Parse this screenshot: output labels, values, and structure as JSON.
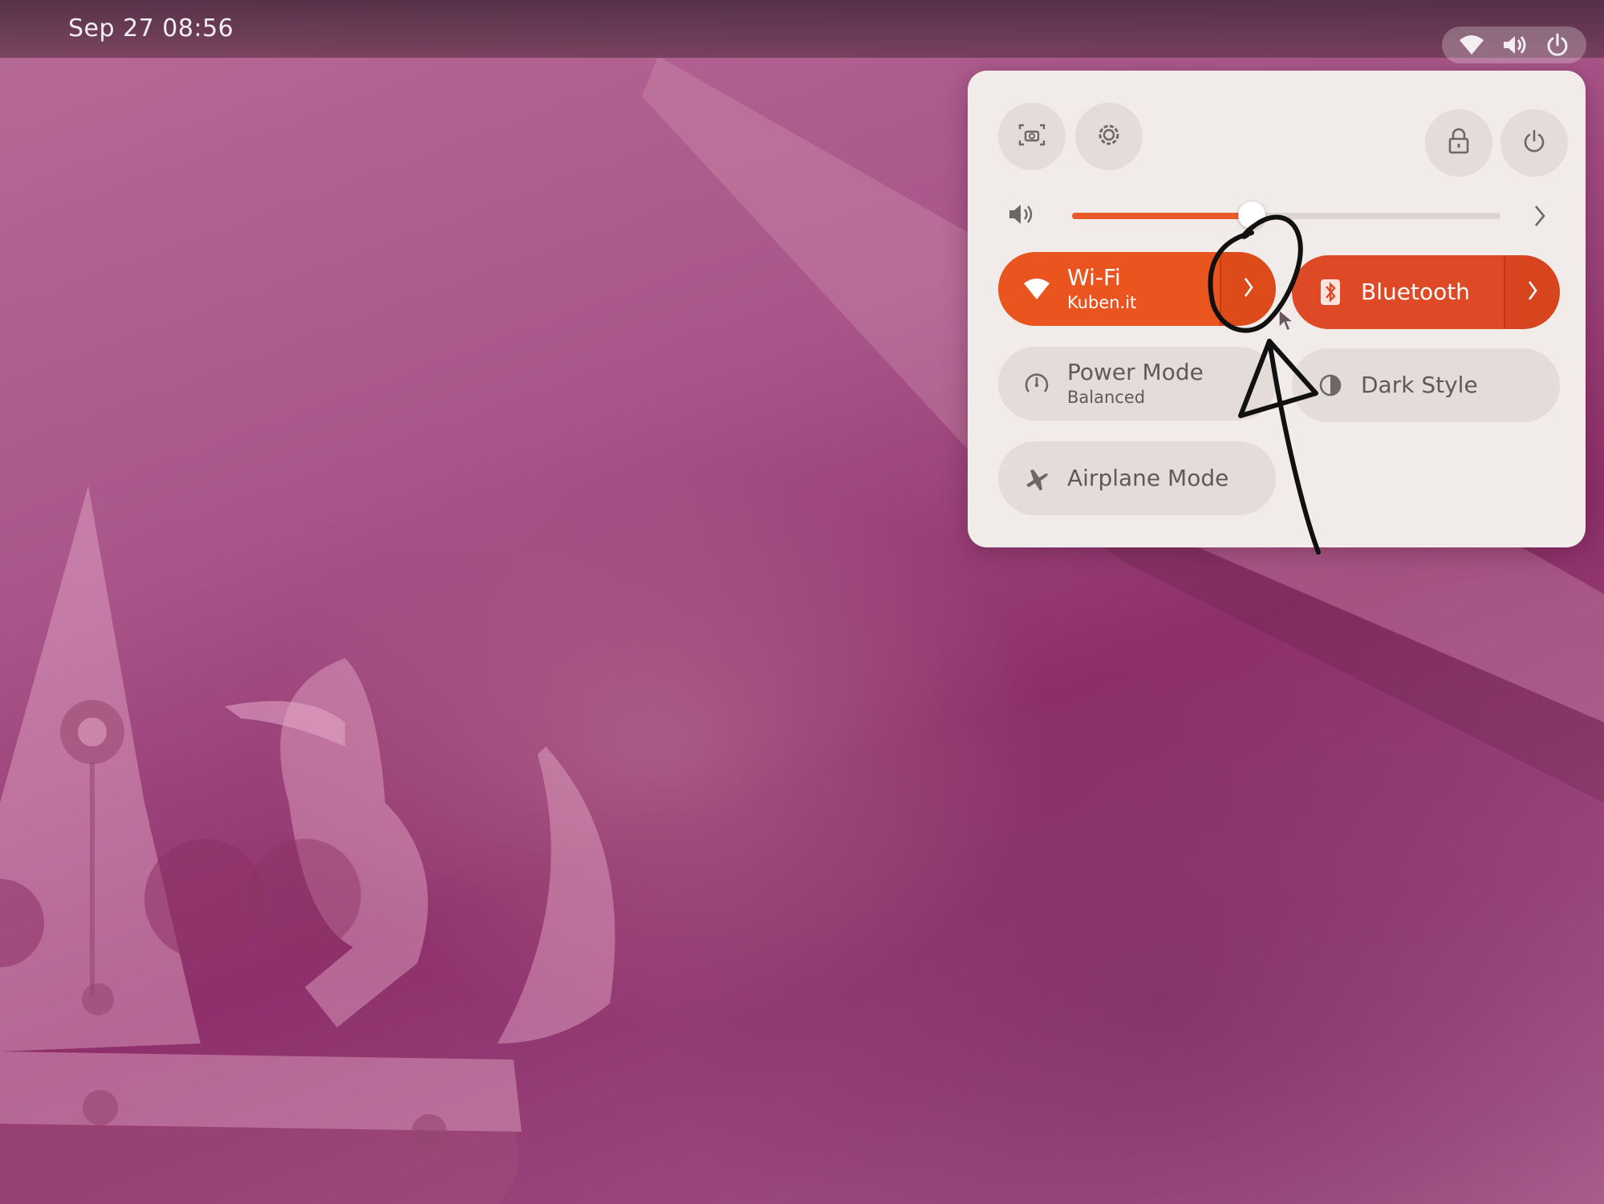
{
  "topbar": {
    "clock": "Sep 27  08:56",
    "status_icons": [
      "wifi-icon",
      "volume-icon",
      "power-icon"
    ]
  },
  "quick_settings": {
    "top_buttons": [
      "screenshot-icon",
      "settings-icon",
      "lock-icon",
      "power-icon"
    ],
    "volume": {
      "icon": "volume-icon",
      "level": 0.42,
      "accent": "#ea5b2b"
    },
    "wifi": {
      "title": "Wi-Fi",
      "subtitle": "Kuben.it",
      "active": true
    },
    "bluetooth": {
      "title": "Bluetooth",
      "active": true
    },
    "power_mode": {
      "title": "Power Mode",
      "subtitle": "Balanced",
      "active": false
    },
    "dark_style": {
      "title": "Dark Style",
      "active": false
    },
    "airplane_mode": {
      "title": "Airplane Mode",
      "active": false
    }
  },
  "colors": {
    "accent_orange": "#e9541f",
    "panel_bg": "#f1ece9",
    "wallpaper": "#a9558a"
  }
}
